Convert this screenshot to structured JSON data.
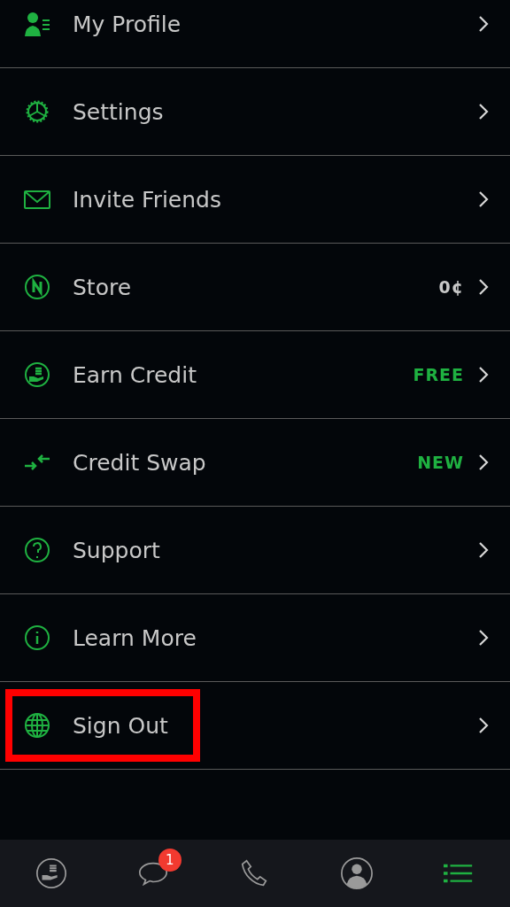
{
  "menu": [
    {
      "label": "My Profile",
      "highlighted": false
    },
    {
      "label": "Settings",
      "highlighted": false
    },
    {
      "label": "Invite Friends",
      "highlighted": false
    },
    {
      "label": "Store",
      "detail": "0¢",
      "detail_accent": false,
      "highlighted": false
    },
    {
      "label": "Earn Credit",
      "detail": "FREE",
      "detail_accent": true,
      "highlighted": false
    },
    {
      "label": "Credit Swap",
      "detail": "NEW",
      "detail_accent": true,
      "highlighted": false
    },
    {
      "label": "Support",
      "highlighted": false
    },
    {
      "label": "Learn More",
      "highlighted": false
    },
    {
      "label": "Sign Out",
      "highlighted": true
    }
  ],
  "tab_bar": [
    {
      "selected": false
    },
    {
      "selected": false,
      "badge": "1"
    },
    {
      "selected": false
    },
    {
      "selected": false
    },
    {
      "selected": true
    }
  ]
}
